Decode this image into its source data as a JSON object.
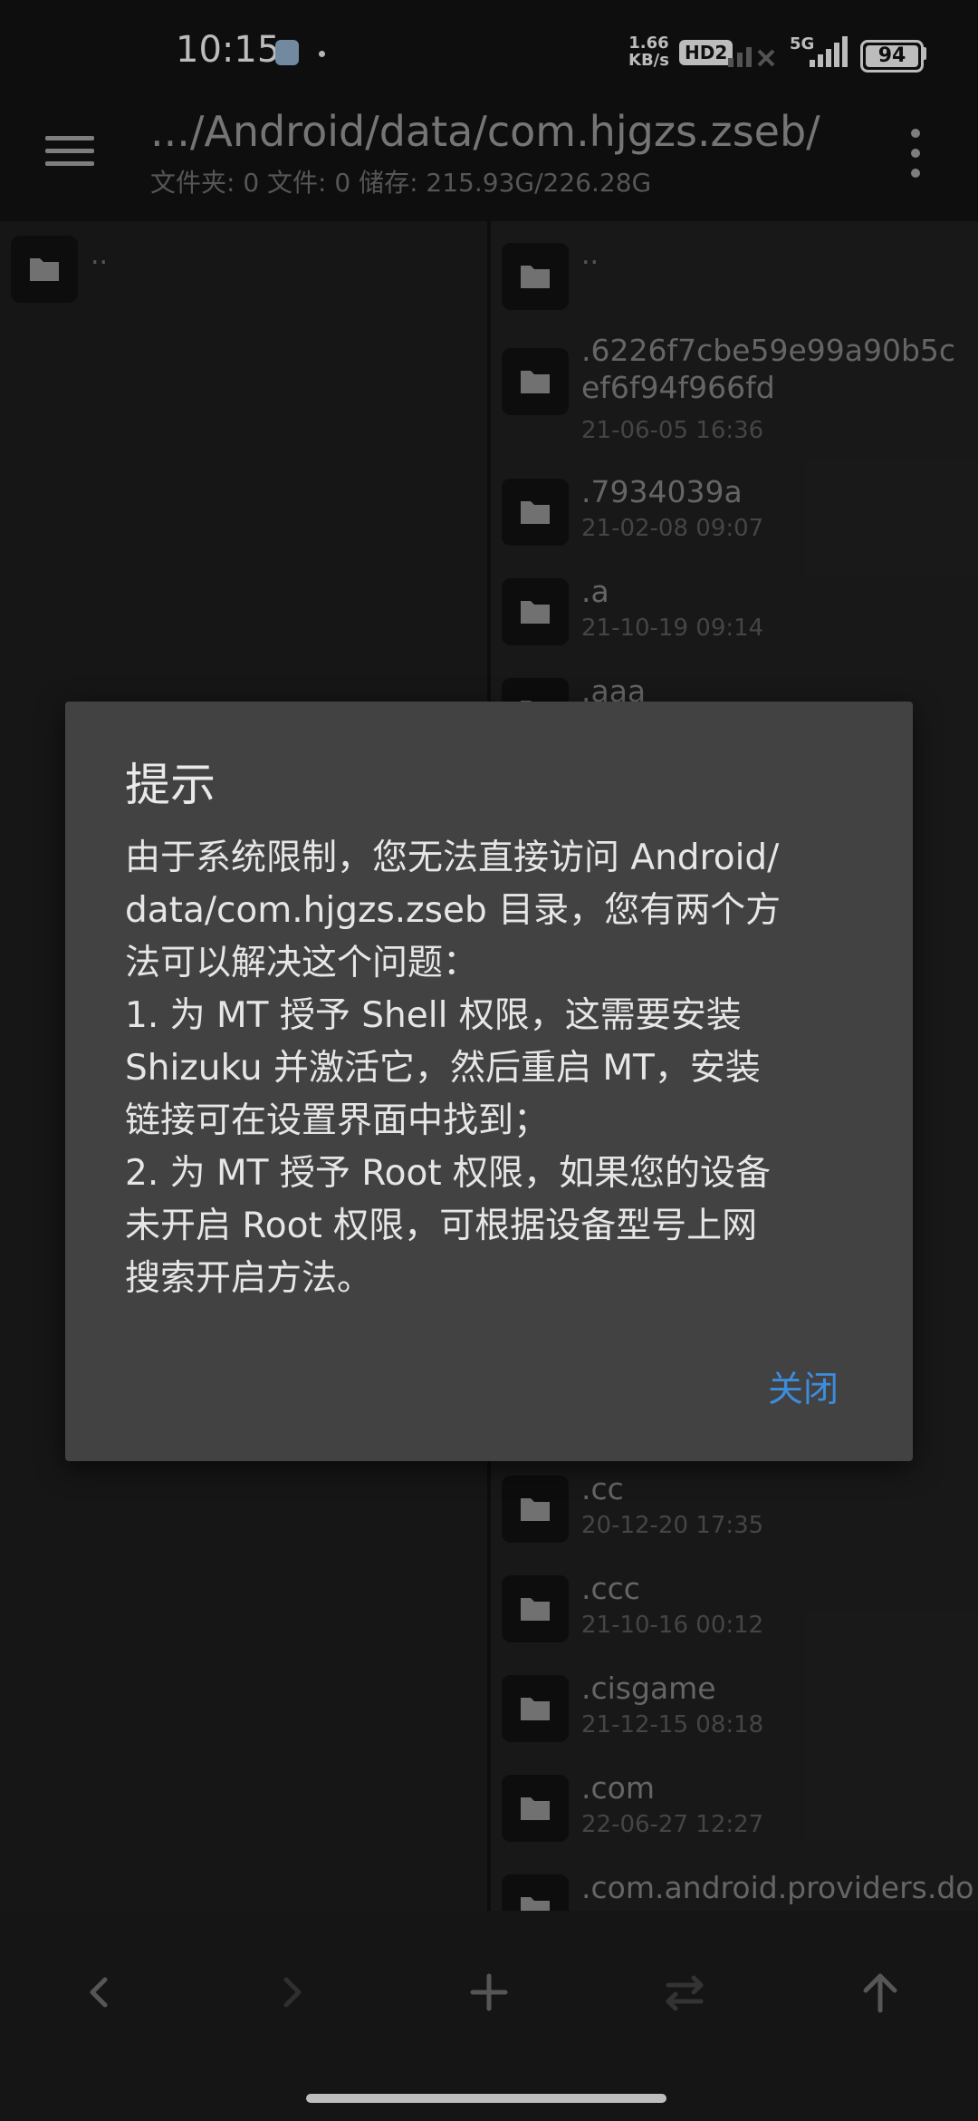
{
  "status_bar": {
    "time": "10:15",
    "net_speed_value": "1.66",
    "net_speed_unit": "KB/s",
    "hd_badge": "HD2",
    "network_type": "5G",
    "battery_level": "94"
  },
  "toolbar": {
    "path": ".../Android/data/com.hjgzs.zseb/",
    "stats": "文件夹: 0  文件: 0  储存: 215.93G/226.28G"
  },
  "left_pane": {
    "parent_label": ".."
  },
  "right_pane": {
    "parent_label": "..",
    "items": [
      {
        "name": ".6226f7cbe59e99a90b5cef6f94f966fd",
        "date": "21-06-05 16:36"
      },
      {
        "name": ".7934039a",
        "date": "21-02-08 09:07"
      },
      {
        "name": ".a",
        "date": "21-10-19 09:14"
      },
      {
        "name": ".aaa",
        "date": ""
      },
      {
        "name": ".cc",
        "date": "20-12-20 17:35"
      },
      {
        "name": ".ccc",
        "date": "21-10-16 00:12"
      },
      {
        "name": ".cisgame",
        "date": "21-12-15 08:18"
      },
      {
        "name": ".com",
        "date": "22-06-27 12:27"
      },
      {
        "name": ".com.android.providers.do",
        "date": ""
      }
    ]
  },
  "dialog": {
    "title": "提示",
    "body": "由于系统限制，您无法直接访问 Android/\ndata/com.hjgzs.zseb 目录，您有两个方\n法可以解决这个问题：\n1. 为 MT 授予 Shell 权限，这需要安装\nShizuku 并激活它，然后重启 MT，安装\n链接可在设置界面中找到；\n2. 为 MT 授予 Root 权限，如果您的设备\n未开启 Root 权限，可根据设备型号上网\n搜索开启方法。",
    "close_label": "关闭"
  },
  "bottom_bar": {
    "icons": [
      "back-icon",
      "forward-icon",
      "add-icon",
      "swap-icon",
      "up-arrow-icon"
    ]
  },
  "colors": {
    "accent": "#3d8ddd",
    "dialog_bg": "#424242",
    "background": "#1b1b1b"
  }
}
